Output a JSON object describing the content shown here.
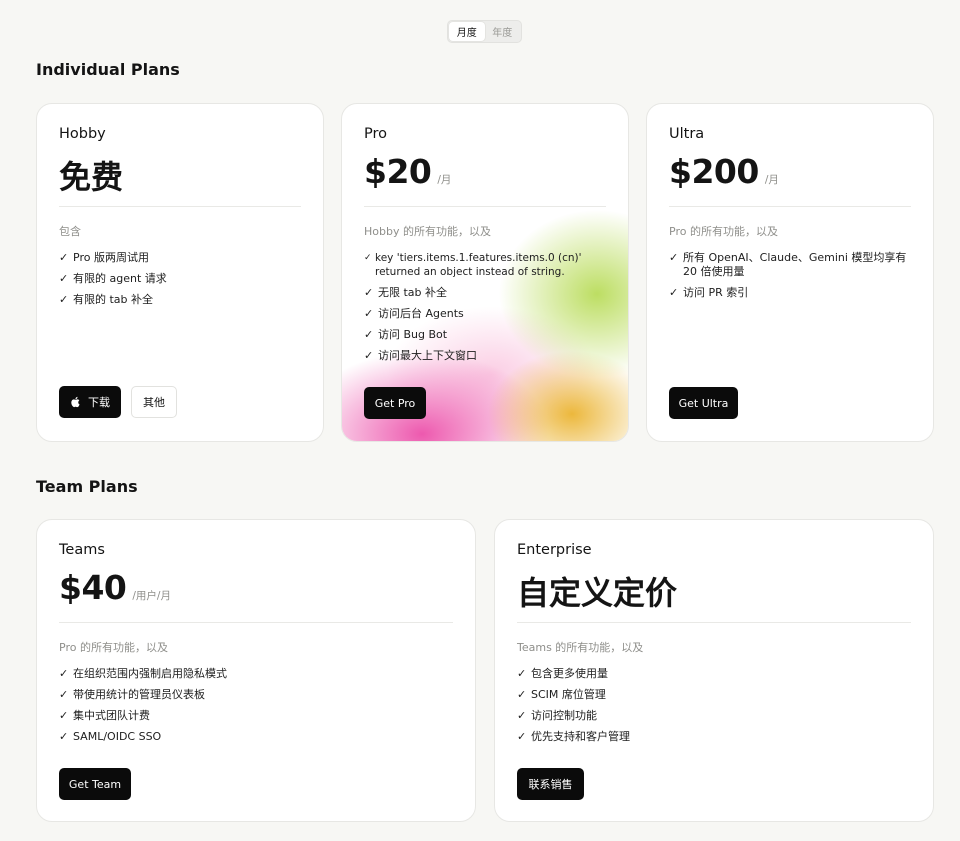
{
  "billing_toggle": {
    "monthly": "月度",
    "yearly": "年度"
  },
  "sections": {
    "individual": "Individual Plans",
    "team": "Team Plans"
  },
  "hobby": {
    "name": "Hobby",
    "price": "免费",
    "includes": "包含",
    "features": [
      "Pro 版两周试用",
      "有限的 agent 请求",
      "有限的 tab 补全"
    ],
    "buttons": {
      "download": "下载",
      "other": "其他"
    }
  },
  "pro": {
    "name": "Pro",
    "price": "$20",
    "unit": "/月",
    "includes": "Hobby 的所有功能，以及",
    "features": [
      "key 'tiers.items.1.features.items.0 (cn)' returned an object instead of string.",
      "无限 tab 补全",
      "访问后台 Agents",
      "访问 Bug Bot",
      "访问最大上下文窗口"
    ],
    "button": "Get Pro"
  },
  "ultra": {
    "name": "Ultra",
    "price": "$200",
    "unit": "/月",
    "includes": "Pro 的所有功能，以及",
    "features": [
      "所有 OpenAI、Claude、Gemini 模型均享有 20 倍使用量",
      "访问 PR 索引"
    ],
    "button": "Get Ultra"
  },
  "teams": {
    "name": "Teams",
    "price": "$40",
    "unit": "/用户/月",
    "includes": "Pro 的所有功能，以及",
    "features": [
      "在组织范围内强制启用隐私模式",
      "带使用统计的管理员仪表板",
      "集中式团队计费",
      "SAML/OIDC SSO"
    ],
    "button": "Get Team"
  },
  "enterprise": {
    "name": "Enterprise",
    "price": "自定义定价",
    "includes": "Teams 的所有功能，以及",
    "features": [
      "包含更多使用量",
      "SCIM 席位管理",
      "访问控制功能",
      "优先支持和客户管理"
    ],
    "button": "联系销售"
  },
  "check_mark": "✓"
}
